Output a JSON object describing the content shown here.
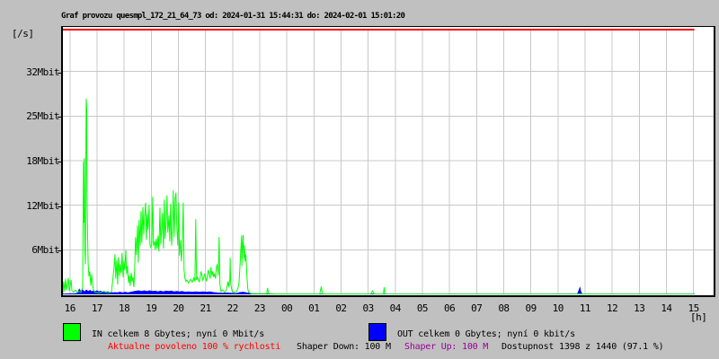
{
  "header": {
    "title": "Graf provozu quesmpl_172_21_64_73 od: 2024-01-31 15:44:31 do: 2024-02-01 15:01:20"
  },
  "footer": {
    "allowed": "Aktualne povoleno 100 % rychlosti",
    "shaper_down": "Shaper Down: 100 M",
    "shaper_up": "Shaper Up: 100 M",
    "availability": "Dostupnost 1398 z 1440 (97.1 %)"
  },
  "colors": {
    "background": "#c0c0c0",
    "plot_background": "#ffffff",
    "grid": "#c8c8c8",
    "in_series": "#00ff00",
    "out_series": "#0000ff",
    "cap_line": "#ff0000",
    "allowed_text": "#ff0000",
    "shaper_up_text": "#990099",
    "text": "#000000"
  },
  "chart_data": {
    "type": "line",
    "title": "Graf provozu quesmpl_172_21_64_73 od: 2024-01-31 15:44:31 do: 2024-02-01 15:01:20",
    "y_unit": "[/s]",
    "x_unit": "[h]",
    "hours_span": 24,
    "first_tick_hour_offset": 0.258,
    "x_tick_labels": [
      "16",
      "17",
      "18",
      "19",
      "20",
      "21",
      "22",
      "23",
      "00",
      "01",
      "02",
      "03",
      "04",
      "05",
      "06",
      "07",
      "08",
      "09",
      "10",
      "11",
      "12",
      "13",
      "14",
      "15"
    ],
    "y_ticks": [
      {
        "value": 6,
        "label": "6Mbit"
      },
      {
        "value": 12,
        "label": "12Mbit"
      },
      {
        "value": 18,
        "label": "18Mbit"
      },
      {
        "value": 25,
        "label": "25Mbit"
      },
      {
        "value": 32,
        "label": "32Mbit"
      }
    ],
    "ylim": [
      0,
      37.3
    ],
    "grid": true,
    "cap_line": {
      "color": "#ff0000",
      "from_hour": 0,
      "to_hour": 23.28
    },
    "data_end_hour": 23.28,
    "series": [
      {
        "name": "OUT",
        "legend": "OUT celkem 0 Gbytes; nyní 0 kbit/s",
        "color": "#0000ff",
        "style": "filled",
        "points": [
          [
            0,
            0.05
          ],
          [
            0.45,
            0.1
          ],
          [
            0.55,
            0.15
          ],
          [
            0.6,
            0.7
          ],
          [
            0.66,
            0.4
          ],
          [
            0.73,
            0.6
          ],
          [
            0.8,
            0.3
          ],
          [
            0.86,
            0.6
          ],
          [
            0.93,
            0.4
          ],
          [
            1.0,
            0.55
          ],
          [
            1.06,
            0.35
          ],
          [
            1.13,
            0.5
          ],
          [
            1.19,
            0.4
          ],
          [
            1.26,
            0.5
          ],
          [
            1.32,
            0.35
          ],
          [
            1.39,
            0.45
          ],
          [
            1.46,
            0.3
          ],
          [
            1.52,
            0.4
          ],
          [
            1.59,
            0.3
          ],
          [
            1.65,
            0.35
          ],
          [
            1.72,
            0.25
          ],
          [
            1.79,
            0.3
          ],
          [
            1.85,
            0.2
          ],
          [
            1.92,
            0.25
          ],
          [
            2.0,
            0.2
          ],
          [
            2.1,
            0.3
          ],
          [
            2.2,
            0.2
          ],
          [
            2.3,
            0.3
          ],
          [
            2.4,
            0.2
          ],
          [
            2.5,
            0.3
          ],
          [
            2.65,
            0.4
          ],
          [
            2.8,
            0.5
          ],
          [
            2.9,
            0.4
          ],
          [
            3.0,
            0.5
          ],
          [
            3.1,
            0.4
          ],
          [
            3.2,
            0.5
          ],
          [
            3.3,
            0.4
          ],
          [
            3.4,
            0.45
          ],
          [
            3.5,
            0.35
          ],
          [
            3.6,
            0.45
          ],
          [
            3.7,
            0.35
          ],
          [
            3.8,
            0.45
          ],
          [
            3.9,
            0.4
          ],
          [
            4.0,
            0.45
          ],
          [
            4.1,
            0.35
          ],
          [
            4.2,
            0.4
          ],
          [
            4.3,
            0.35
          ],
          [
            4.4,
            0.4
          ],
          [
            4.5,
            0.3
          ],
          [
            4.63,
            0.35
          ],
          [
            4.77,
            0.3
          ],
          [
            4.9,
            0.35
          ],
          [
            5.03,
            0.3
          ],
          [
            5.16,
            0.35
          ],
          [
            5.3,
            0.3
          ],
          [
            5.43,
            0.35
          ],
          [
            5.56,
            0.25
          ],
          [
            5.7,
            0.2
          ],
          [
            5.9,
            0.15
          ],
          [
            6.06,
            0.2
          ],
          [
            6.19,
            0.15
          ],
          [
            6.39,
            0.1
          ],
          [
            6.52,
            0.25
          ],
          [
            6.65,
            0.3
          ],
          [
            6.79,
            0.2
          ],
          [
            6.95,
            0.1
          ],
          [
            7.28,
            0.05
          ],
          [
            7.6,
            0.05
          ],
          [
            8.5,
            0.03
          ],
          [
            10,
            0.03
          ],
          [
            12,
            0.03
          ],
          [
            14,
            0.03
          ],
          [
            16,
            0.03
          ],
          [
            18,
            0.03
          ],
          [
            18.98,
            0.05
          ],
          [
            19.03,
            0.5
          ],
          [
            19.07,
            0.9
          ],
          [
            19.1,
            0.3
          ],
          [
            19.15,
            0.05
          ],
          [
            20,
            0.02
          ],
          [
            22,
            0.02
          ],
          [
            23.28,
            0.02
          ]
        ]
      },
      {
        "name": "IN",
        "legend": "IN celkem 8 Gbytes; nyní 0 Mbit/s",
        "color": "#00ff00",
        "style": "line",
        "points": [
          [
            0,
            0.2
          ],
          [
            0.03,
            1.8
          ],
          [
            0.07,
            0.4
          ],
          [
            0.1,
            2.2
          ],
          [
            0.13,
            0.6
          ],
          [
            0.17,
            1.5
          ],
          [
            0.2,
            2.3
          ],
          [
            0.23,
            0.5
          ],
          [
            0.27,
            1.2
          ],
          [
            0.3,
            2.0
          ],
          [
            0.33,
            0.5
          ],
          [
            0.4,
            0.3
          ],
          [
            0.46,
            0.6
          ],
          [
            0.53,
            0.3
          ],
          [
            0.6,
            0.4
          ],
          [
            0.66,
            0.3
          ],
          [
            0.73,
            1.0
          ],
          [
            0.76,
            18.5
          ],
          [
            0.78,
            10
          ],
          [
            0.79,
            19
          ],
          [
            0.81,
            6
          ],
          [
            0.83,
            4.2
          ],
          [
            0.84,
            14
          ],
          [
            0.86,
            27.3
          ],
          [
            0.88,
            25.8
          ],
          [
            0.89,
            14
          ],
          [
            0.91,
            8
          ],
          [
            0.93,
            4.2
          ],
          [
            0.96,
            2.5
          ],
          [
            0.99,
            3.2
          ],
          [
            1.03,
            1.2
          ],
          [
            1.06,
            2.8
          ],
          [
            1.09,
            1.5
          ],
          [
            1.13,
            0.6
          ],
          [
            1.19,
            0.3
          ],
          [
            1.32,
            0.2
          ],
          [
            1.49,
            0.4
          ],
          [
            1.66,
            0.2
          ],
          [
            1.79,
            0.3
          ],
          [
            1.89,
            3.8
          ],
          [
            1.92,
            5.6
          ],
          [
            1.95,
            2.2
          ],
          [
            1.99,
            4.8
          ],
          [
            2.02,
            1.4
          ],
          [
            2.05,
            5.2
          ],
          [
            2.09,
            2.6
          ],
          [
            2.12,
            4.2
          ],
          [
            2.15,
            3.0
          ],
          [
            2.18,
            5.8
          ],
          [
            2.22,
            2.4
          ],
          [
            2.25,
            4.6
          ],
          [
            2.28,
            3.4
          ],
          [
            2.32,
            6.2
          ],
          [
            2.35,
            2.8
          ],
          [
            2.38,
            4.0
          ],
          [
            2.42,
            1.6
          ],
          [
            2.45,
            2.6
          ],
          [
            2.48,
            1.2
          ],
          [
            2.52,
            3.0
          ],
          [
            2.55,
            1.8
          ],
          [
            2.58,
            2.4
          ],
          [
            2.62,
            1.0
          ],
          [
            2.65,
            3.6
          ],
          [
            2.68,
            8.0
          ],
          [
            2.71,
            5.5
          ],
          [
            2.75,
            9.6
          ],
          [
            2.78,
            4.4
          ],
          [
            2.81,
            10.4
          ],
          [
            2.85,
            6.8
          ],
          [
            2.88,
            11.6
          ],
          [
            2.91,
            7.2
          ],
          [
            2.95,
            12.2
          ],
          [
            2.98,
            8.4
          ],
          [
            3.01,
            10.6
          ],
          [
            3.05,
            12.8
          ],
          [
            3.08,
            7.6
          ],
          [
            3.11,
            11.2
          ],
          [
            3.14,
            9.0
          ],
          [
            3.18,
            12.4
          ],
          [
            3.21,
            7.0
          ],
          [
            3.24,
            6.6
          ],
          [
            3.28,
            7.2
          ],
          [
            3.31,
            13.6
          ],
          [
            3.34,
            6.8
          ],
          [
            3.38,
            7.4
          ],
          [
            3.41,
            6.2
          ],
          [
            3.44,
            7.8
          ],
          [
            3.48,
            6.4
          ],
          [
            3.51,
            8.2
          ],
          [
            3.54,
            6.0
          ],
          [
            3.58,
            12.1
          ],
          [
            3.61,
            7.0
          ],
          [
            3.64,
            8.8
          ],
          [
            3.67,
            11.4
          ],
          [
            3.71,
            6.4
          ],
          [
            3.74,
            13.2
          ],
          [
            3.77,
            7.8
          ],
          [
            3.81,
            10.2
          ],
          [
            3.84,
            13.8
          ],
          [
            3.87,
            8.6
          ],
          [
            3.91,
            11.0
          ],
          [
            3.94,
            7.4
          ],
          [
            3.97,
            12.6
          ],
          [
            4.01,
            6.8
          ],
          [
            4.04,
            9.2
          ],
          [
            4.07,
            14.5
          ],
          [
            4.1,
            8.0
          ],
          [
            4.14,
            13.4
          ],
          [
            4.17,
            14.2
          ],
          [
            4.2,
            9.6
          ],
          [
            4.24,
            6.8
          ],
          [
            4.27,
            12.8
          ],
          [
            4.3,
            5.4
          ],
          [
            4.34,
            7.6
          ],
          [
            4.37,
            4.6
          ],
          [
            4.4,
            6.2
          ],
          [
            4.44,
            12.8
          ],
          [
            4.47,
            3.4
          ],
          [
            4.5,
            2.2
          ],
          [
            4.54,
            1.8
          ],
          [
            4.57,
            2.0
          ],
          [
            4.63,
            1.6
          ],
          [
            4.7,
            2.1
          ],
          [
            4.77,
            1.7
          ],
          [
            4.83,
            2.3
          ],
          [
            4.87,
            1.8
          ],
          [
            4.9,
            10.5
          ],
          [
            4.93,
            2.0
          ],
          [
            4.97,
            2.4
          ],
          [
            5.03,
            1.7
          ],
          [
            5.1,
            3.2
          ],
          [
            5.16,
            2.0
          ],
          [
            5.23,
            2.8
          ],
          [
            5.3,
            1.8
          ],
          [
            5.36,
            3.4
          ],
          [
            5.43,
            2.2
          ],
          [
            5.46,
            3.8
          ],
          [
            5.5,
            2.6
          ],
          [
            5.53,
            3.2
          ],
          [
            5.56,
            2.4
          ],
          [
            5.59,
            2.9
          ],
          [
            5.63,
            2.2
          ],
          [
            5.66,
            3.6
          ],
          [
            5.69,
            4.2
          ],
          [
            5.73,
            2.6
          ],
          [
            5.76,
            8.0
          ],
          [
            5.79,
            1.4
          ],
          [
            5.83,
            0.4
          ],
          [
            5.89,
            0.6
          ],
          [
            5.96,
            0.3
          ],
          [
            6.02,
            0.5
          ],
          [
            6.06,
            1.2
          ],
          [
            6.09,
            1.8
          ],
          [
            6.12,
            1.0
          ],
          [
            6.16,
            2.2
          ],
          [
            6.17,
            5.1
          ],
          [
            6.19,
            1.6
          ],
          [
            6.22,
            0.8
          ],
          [
            6.26,
            0.3
          ],
          [
            6.39,
            0.3
          ],
          [
            6.45,
            0.8
          ],
          [
            6.49,
            1.4
          ],
          [
            6.52,
            3.2
          ],
          [
            6.55,
            5.4
          ],
          [
            6.59,
            8.2
          ],
          [
            6.6,
            4.0
          ],
          [
            6.62,
            6.4
          ],
          [
            6.65,
            8.3
          ],
          [
            6.67,
            5.0
          ],
          [
            6.69,
            6.8
          ],
          [
            6.72,
            4.6
          ],
          [
            6.75,
            5.6
          ],
          [
            6.79,
            2.4
          ],
          [
            6.82,
            0.8
          ],
          [
            6.85,
            0.3
          ],
          [
            6.95,
            0.1
          ],
          [
            7.28,
            0.1
          ],
          [
            7.51,
            0.1
          ],
          [
            7.55,
            0.9
          ],
          [
            7.58,
            0.1
          ],
          [
            7.94,
            0.05
          ],
          [
            9.47,
            0.05
          ],
          [
            9.53,
            1.1
          ],
          [
            9.57,
            0.05
          ],
          [
            11.35,
            0.05
          ],
          [
            11.42,
            0.5
          ],
          [
            11.49,
            0.05
          ],
          [
            11.82,
            0.05
          ],
          [
            11.85,
            1.0
          ],
          [
            11.88,
            0.05
          ],
          [
            12.25,
            0.02
          ],
          [
            18.9,
            0.02
          ],
          [
            19.07,
            0.1
          ],
          [
            19.2,
            0.02
          ],
          [
            23.28,
            0.02
          ]
        ]
      }
    ]
  }
}
